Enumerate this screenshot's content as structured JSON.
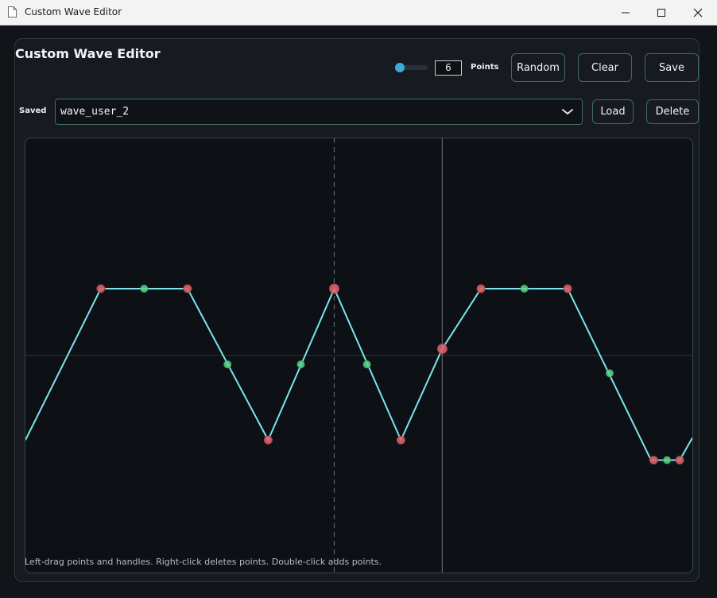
{
  "window": {
    "title": "Custom Wave Editor",
    "icons": [
      "document-icon",
      "minimize-icon",
      "maximize-icon",
      "close-icon"
    ]
  },
  "header": {
    "title": "Custom Wave Editor",
    "points_value": "6",
    "points_label": "Points",
    "slider_level": 0.1,
    "buttons": {
      "random": "Random",
      "clear": "Clear",
      "save": "Save"
    }
  },
  "saved": {
    "label": "Saved",
    "selected": "wave_user_2",
    "load": "Load",
    "delete": "Delete"
  },
  "editor": {
    "hint": "Left-drag points and handles. Right-click deletes points. Double-click adds points.",
    "colors": {
      "wave": "#79e6ee",
      "point": "#d9646b",
      "handle": "#5fd88a",
      "axis": "#2d3338",
      "playhead": "#5d6368"
    },
    "wave_path": [
      [
        0.0,
        -0.38
      ],
      [
        0.113,
        0.3
      ],
      [
        0.243,
        0.3
      ],
      [
        0.364,
        -0.38
      ],
      [
        0.463,
        0.3
      ],
      [
        0.563,
        -0.38
      ],
      [
        0.625,
        0.03
      ],
      [
        0.683,
        0.3
      ],
      [
        0.813,
        0.3
      ],
      [
        0.938,
        -0.47
      ],
      [
        0.981,
        -0.47
      ],
      [
        1.0,
        -0.37
      ]
    ],
    "anchor_points": [
      [
        0.113,
        0.3
      ],
      [
        0.243,
        0.3
      ],
      [
        0.364,
        -0.38
      ],
      [
        0.463,
        0.3
      ],
      [
        0.563,
        -0.38
      ],
      [
        0.625,
        0.03
      ],
      [
        0.683,
        0.3
      ],
      [
        0.813,
        0.3
      ],
      [
        0.942,
        -0.47
      ],
      [
        0.981,
        -0.47
      ]
    ],
    "handle_points": [
      [
        0.178,
        0.3
      ],
      [
        0.303,
        -0.04
      ],
      [
        0.413,
        -0.04
      ],
      [
        0.512,
        -0.04
      ],
      [
        0.748,
        0.3
      ],
      [
        0.876,
        -0.08
      ],
      [
        0.962,
        -0.47
      ]
    ],
    "playhead_positions": [
      0.463,
      0.625
    ]
  }
}
